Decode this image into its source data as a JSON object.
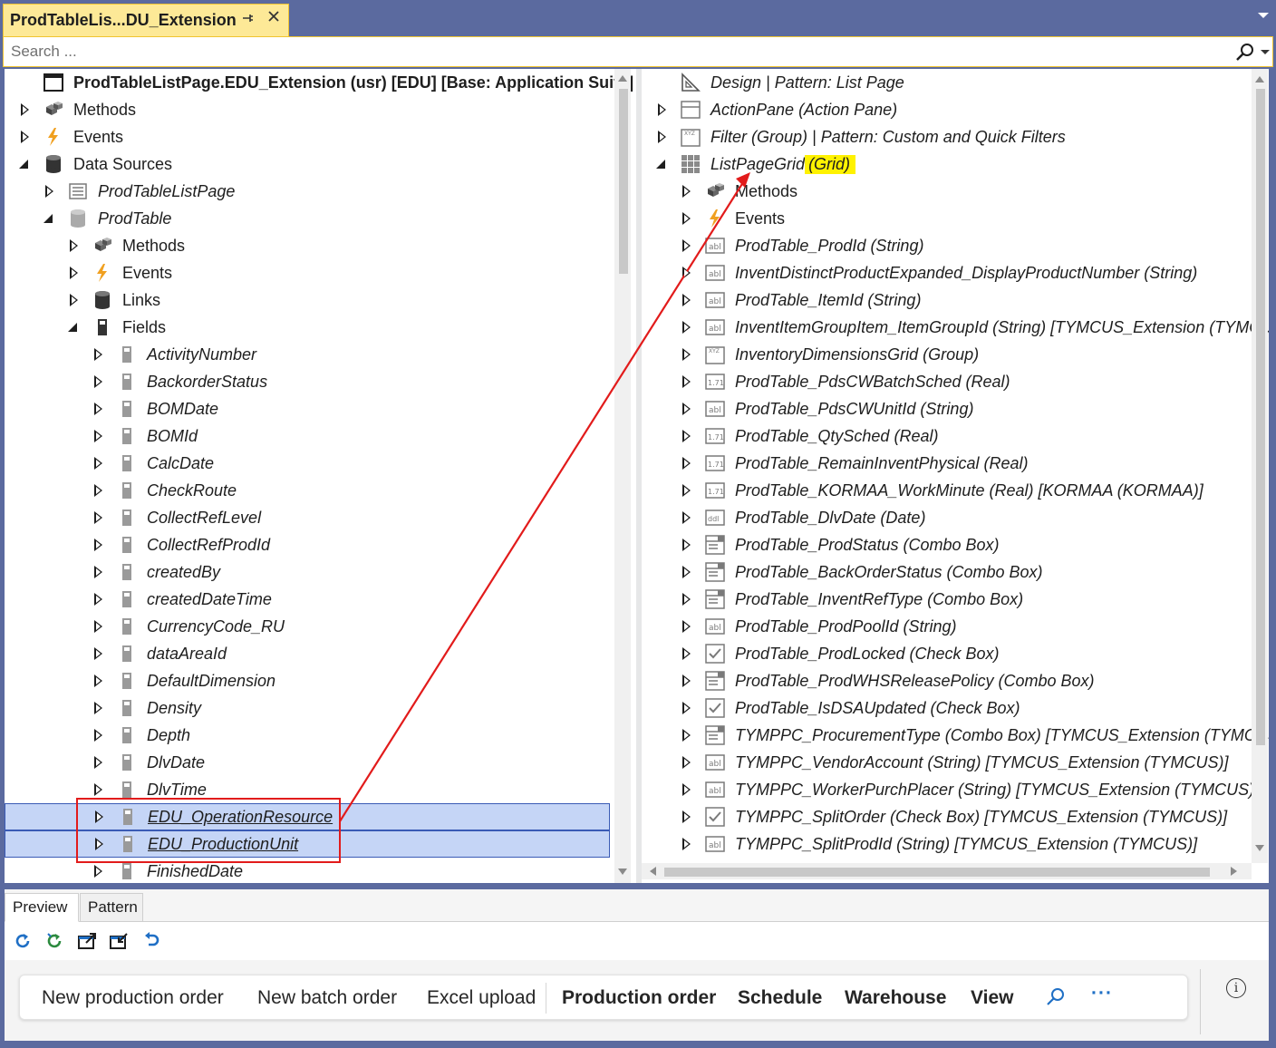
{
  "tab": {
    "title": "ProdTableLis...DU_Extension",
    "pin": "⊕",
    "close": "✕"
  },
  "search": {
    "placeholder": "Search ..."
  },
  "left_tree": [
    {
      "label": "ProdTableListPage.EDU_Extension (usr) [EDU] [Base: Application Suite]",
      "icon": "form-icon",
      "exp": "none",
      "level": 0,
      "style": "b"
    },
    {
      "label": "Methods",
      "icon": "methods-icon",
      "exp": "collapsed",
      "level": 0,
      "style": ""
    },
    {
      "label": "Events",
      "icon": "events-icon",
      "exp": "collapsed",
      "level": 0,
      "style": ""
    },
    {
      "label": "Data Sources",
      "icon": "datasources-icon",
      "exp": "expanded",
      "level": 0,
      "style": ""
    },
    {
      "label": "ProdTableListPage",
      "icon": "query-icon",
      "exp": "collapsed",
      "level": 1,
      "style": "i"
    },
    {
      "label": "ProdTable",
      "icon": "table-icon",
      "exp": "expanded",
      "level": 1,
      "style": "i"
    },
    {
      "label": "Methods",
      "icon": "methods-icon",
      "exp": "collapsed",
      "level": 2,
      "style": ""
    },
    {
      "label": "Events",
      "icon": "events-icon",
      "exp": "collapsed",
      "level": 2,
      "style": ""
    },
    {
      "label": "Links",
      "icon": "links-icon",
      "exp": "collapsed",
      "level": 2,
      "style": ""
    },
    {
      "label": "Fields",
      "icon": "fields-icon",
      "exp": "expanded",
      "level": 2,
      "style": ""
    },
    {
      "label": "ActivityNumber",
      "icon": "field-icon",
      "exp": "collapsed",
      "level": 3,
      "style": "i"
    },
    {
      "label": "BackorderStatus",
      "icon": "field-icon",
      "exp": "collapsed",
      "level": 3,
      "style": "i"
    },
    {
      "label": "BOMDate",
      "icon": "field-icon",
      "exp": "collapsed",
      "level": 3,
      "style": "i"
    },
    {
      "label": "BOMId",
      "icon": "field-icon",
      "exp": "collapsed",
      "level": 3,
      "style": "i"
    },
    {
      "label": "CalcDate",
      "icon": "field-icon",
      "exp": "collapsed",
      "level": 3,
      "style": "i"
    },
    {
      "label": "CheckRoute",
      "icon": "field-icon",
      "exp": "collapsed",
      "level": 3,
      "style": "i"
    },
    {
      "label": "CollectRefLevel",
      "icon": "field-icon",
      "exp": "collapsed",
      "level": 3,
      "style": "i"
    },
    {
      "label": "CollectRefProdId",
      "icon": "field-icon",
      "exp": "collapsed",
      "level": 3,
      "style": "i"
    },
    {
      "label": "createdBy",
      "icon": "field-icon",
      "exp": "collapsed",
      "level": 3,
      "style": "i"
    },
    {
      "label": "createdDateTime",
      "icon": "field-icon",
      "exp": "collapsed",
      "level": 3,
      "style": "i"
    },
    {
      "label": "CurrencyCode_RU",
      "icon": "field-icon",
      "exp": "collapsed",
      "level": 3,
      "style": "i"
    },
    {
      "label": "dataAreaId",
      "icon": "field-icon",
      "exp": "collapsed",
      "level": 3,
      "style": "i"
    },
    {
      "label": "DefaultDimension",
      "icon": "field-icon",
      "exp": "collapsed",
      "level": 3,
      "style": "i"
    },
    {
      "label": "Density",
      "icon": "field-icon",
      "exp": "collapsed",
      "level": 3,
      "style": "i"
    },
    {
      "label": "Depth",
      "icon": "field-icon",
      "exp": "collapsed",
      "level": 3,
      "style": "i"
    },
    {
      "label": "DlvDate",
      "icon": "field-icon",
      "exp": "collapsed",
      "level": 3,
      "style": "i"
    },
    {
      "label": "DlvTime",
      "icon": "field-icon",
      "exp": "collapsed",
      "level": 3,
      "style": "i"
    },
    {
      "label": "EDU_OperationResource",
      "icon": "field-icon",
      "exp": "collapsed",
      "level": 3,
      "style": "i",
      "selected": true
    },
    {
      "label": "EDU_ProductionUnit",
      "icon": "field-icon",
      "exp": "collapsed",
      "level": 3,
      "style": "i",
      "selected": true
    },
    {
      "label": "FinishedDate",
      "icon": "field-icon",
      "exp": "collapsed",
      "level": 3,
      "style": "i"
    }
  ],
  "right_tree": [
    {
      "label": "Design | Pattern: List Page",
      "icon": "design-icon",
      "exp": "none",
      "level": 0,
      "style": "i"
    },
    {
      "label": "ActionPane (Action Pane)",
      "icon": "actionpane-icon",
      "exp": "collapsed",
      "level": 0,
      "style": "i"
    },
    {
      "label": "Filter (Group) | Pattern: Custom and Quick Filters",
      "icon": "group-icon",
      "exp": "collapsed",
      "level": 0,
      "style": "i"
    },
    {
      "label": "ListPageGrid",
      "suffix": "(Grid)",
      "icon": "grid-icon",
      "exp": "expanded",
      "level": 0,
      "style": "i"
    },
    {
      "label": "Methods",
      "icon": "methods-icon",
      "exp": "collapsed",
      "level": 1,
      "style": ""
    },
    {
      "label": "Events",
      "icon": "events-icon",
      "exp": "collapsed",
      "level": 1,
      "style": ""
    },
    {
      "label": "ProdTable_ProdId (String)",
      "icon": "string-icon",
      "exp": "collapsed",
      "level": 1,
      "style": "i"
    },
    {
      "label": "InventDistinctProductExpanded_DisplayProductNumber (String)",
      "icon": "string-icon",
      "exp": "collapsed",
      "level": 1,
      "style": "i"
    },
    {
      "label": "ProdTable_ItemId (String)",
      "icon": "string-icon",
      "exp": "collapsed",
      "level": 1,
      "style": "i"
    },
    {
      "label": "InventItemGroupItem_ItemGroupId (String) [TYMCUS_Extension (TYMCUS",
      "icon": "string-icon",
      "exp": "collapsed",
      "level": 1,
      "style": "i"
    },
    {
      "label": "InventoryDimensionsGrid (Group)",
      "icon": "group-icon",
      "exp": "collapsed",
      "level": 1,
      "style": "i"
    },
    {
      "label": "ProdTable_PdsCWBatchSched (Real)",
      "icon": "real-icon",
      "exp": "collapsed",
      "level": 1,
      "style": "i"
    },
    {
      "label": "ProdTable_PdsCWUnitId (String)",
      "icon": "string-icon",
      "exp": "collapsed",
      "level": 1,
      "style": "i"
    },
    {
      "label": "ProdTable_QtySched (Real)",
      "icon": "real-icon",
      "exp": "collapsed",
      "level": 1,
      "style": "i"
    },
    {
      "label": "ProdTable_RemainInventPhysical (Real)",
      "icon": "real-icon",
      "exp": "collapsed",
      "level": 1,
      "style": "i"
    },
    {
      "label": "ProdTable_KORMAA_WorkMinute (Real) [KORMAA (KORMAA)]",
      "icon": "real-icon",
      "exp": "collapsed",
      "level": 1,
      "style": "i"
    },
    {
      "label": "ProdTable_DlvDate (Date)",
      "icon": "date-icon",
      "exp": "collapsed",
      "level": 1,
      "style": "i"
    },
    {
      "label": "ProdTable_ProdStatus (Combo Box)",
      "icon": "combobox-icon",
      "exp": "collapsed",
      "level": 1,
      "style": "i"
    },
    {
      "label": "ProdTable_BackOrderStatus (Combo Box)",
      "icon": "combobox-icon",
      "exp": "collapsed",
      "level": 1,
      "style": "i"
    },
    {
      "label": "ProdTable_InventRefType (Combo Box)",
      "icon": "combobox-icon",
      "exp": "collapsed",
      "level": 1,
      "style": "i"
    },
    {
      "label": "ProdTable_ProdPoolId (String)",
      "icon": "string-icon",
      "exp": "collapsed",
      "level": 1,
      "style": "i"
    },
    {
      "label": "ProdTable_ProdLocked (Check Box)",
      "icon": "checkbox-icon",
      "exp": "collapsed",
      "level": 1,
      "style": "i"
    },
    {
      "label": "ProdTable_ProdWHSReleasePolicy (Combo Box)",
      "icon": "combobox-icon",
      "exp": "collapsed",
      "level": 1,
      "style": "i"
    },
    {
      "label": "ProdTable_IsDSAUpdated (Check Box)",
      "icon": "checkbox-icon",
      "exp": "collapsed",
      "level": 1,
      "style": "i"
    },
    {
      "label": "TYMPPC_ProcurementType (Combo Box) [TYMCUS_Extension (TYMCUS)]",
      "icon": "combobox-icon",
      "exp": "collapsed",
      "level": 1,
      "style": "i"
    },
    {
      "label": "TYMPPC_VendorAccount (String) [TYMCUS_Extension (TYMCUS)]",
      "icon": "string-icon",
      "exp": "collapsed",
      "level": 1,
      "style": "i"
    },
    {
      "label": "TYMPPC_WorkerPurchPlacer (String) [TYMCUS_Extension (TYMCUS)]",
      "icon": "string-icon",
      "exp": "collapsed",
      "level": 1,
      "style": "i"
    },
    {
      "label": "TYMPPC_SplitOrder (Check Box) [TYMCUS_Extension (TYMCUS)]",
      "icon": "checkbox-icon",
      "exp": "collapsed",
      "level": 1,
      "style": "i"
    },
    {
      "label": "TYMPPC_SplitProdId (String) [TYMCUS_Extension (TYMCUS)]",
      "icon": "string-icon",
      "exp": "collapsed",
      "level": 1,
      "style": "i"
    }
  ],
  "bottom": {
    "tabs": [
      "Preview",
      "Pattern"
    ],
    "toolbar_icons": [
      "refresh-icon",
      "refresh-green-icon",
      "open-in-new-icon",
      "export-icon",
      "undo-icon"
    ],
    "action_pane": {
      "buttons": [
        "New production order",
        "New batch order",
        "Excel upload"
      ],
      "groups": [
        "Production order",
        "Schedule",
        "Warehouse",
        "View"
      ],
      "search_icon": "search-icon",
      "more": "···"
    },
    "info": "i"
  },
  "annotation": {
    "color": "#e21b1b"
  },
  "colors": {
    "tab_active": "#fde997",
    "frame": "#5b6a9f",
    "selection": "#c5d5f6",
    "highlight": "#fff200"
  }
}
